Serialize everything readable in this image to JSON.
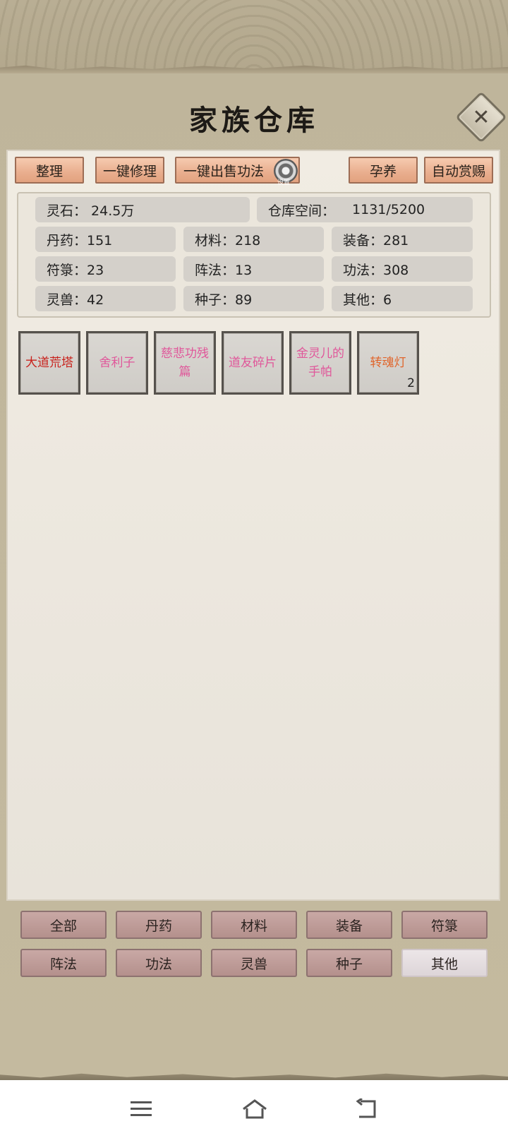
{
  "title": "家族仓库",
  "toolbar": {
    "sort": "整理",
    "repair_all": "一键修理",
    "sell_techniques": "一键出售功法",
    "gear_label": "设置",
    "nurture": "孕养",
    "auto_reward": "自动赏赐"
  },
  "stats": {
    "spirit_stone": "灵石：  24.5万",
    "warehouse_space_label": "仓库空间：",
    "warehouse_space_value": "1131/5200",
    "pills": "丹药：151",
    "materials": "材料：218",
    "equipment": "装备：281",
    "talismans": "符箓：23",
    "formations": "阵法：13",
    "techniques": "功法：308",
    "beasts": "灵兽：42",
    "seeds": "种子：89",
    "others": "其他：6"
  },
  "items": [
    {
      "name": "大道荒塔",
      "color": "#c8221c",
      "qty": ""
    },
    {
      "name": "舍利子",
      "color": "#e0579a",
      "qty": ""
    },
    {
      "name": "慈悲功残篇",
      "color": "#e0579a",
      "qty": ""
    },
    {
      "name": "道友碎片",
      "color": "#e0579a",
      "qty": ""
    },
    {
      "name": "金灵儿的手帕",
      "color": "#e0579a",
      "qty": ""
    },
    {
      "name": "转魂灯",
      "color": "#e0662d",
      "qty": "2"
    }
  ],
  "categories": [
    "全部",
    "丹药",
    "材料",
    "装备",
    "符箓",
    "阵法",
    "功法",
    "灵兽",
    "种子",
    "其他"
  ],
  "active_category": "其他",
  "nav": {
    "menu": "menu-icon",
    "home": "home-icon",
    "back": "back-icon"
  }
}
